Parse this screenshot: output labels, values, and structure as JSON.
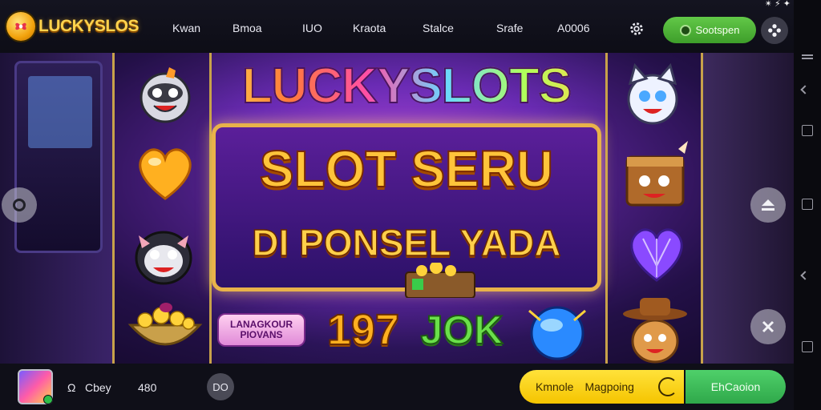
{
  "header": {
    "logo_text": "LUCKYSLOS",
    "nav": [
      "Kwan",
      "Bmoa",
      "IUO",
      "Kraota",
      "Stalce",
      "Srafe",
      "A0006"
    ],
    "play_button_label": "Sootspen"
  },
  "status": {
    "icons_text": "✴ ⚡ ✦"
  },
  "banner": {
    "title": "LUCKYSLOTS",
    "headline": "SLOT SERU",
    "subline": "DI PONSEL YADA",
    "promo_text": "LANAGKOUR PIOVANS",
    "tile_number": "197",
    "tile_word": "JOK"
  },
  "bottom": {
    "label_1": "Ω",
    "label_2": "Cbey",
    "label_3": "480",
    "pill_label": "DO",
    "bet_label_1": "Kmnole",
    "bet_label_2": "Magpoing",
    "go_button_label": "EhCaoion"
  },
  "colors": {
    "accent_gold": "#ffc43a",
    "green_button": "#3e9e2a",
    "yellow_bar": "#f5c400",
    "purple_bg": "#6a2bb4"
  }
}
